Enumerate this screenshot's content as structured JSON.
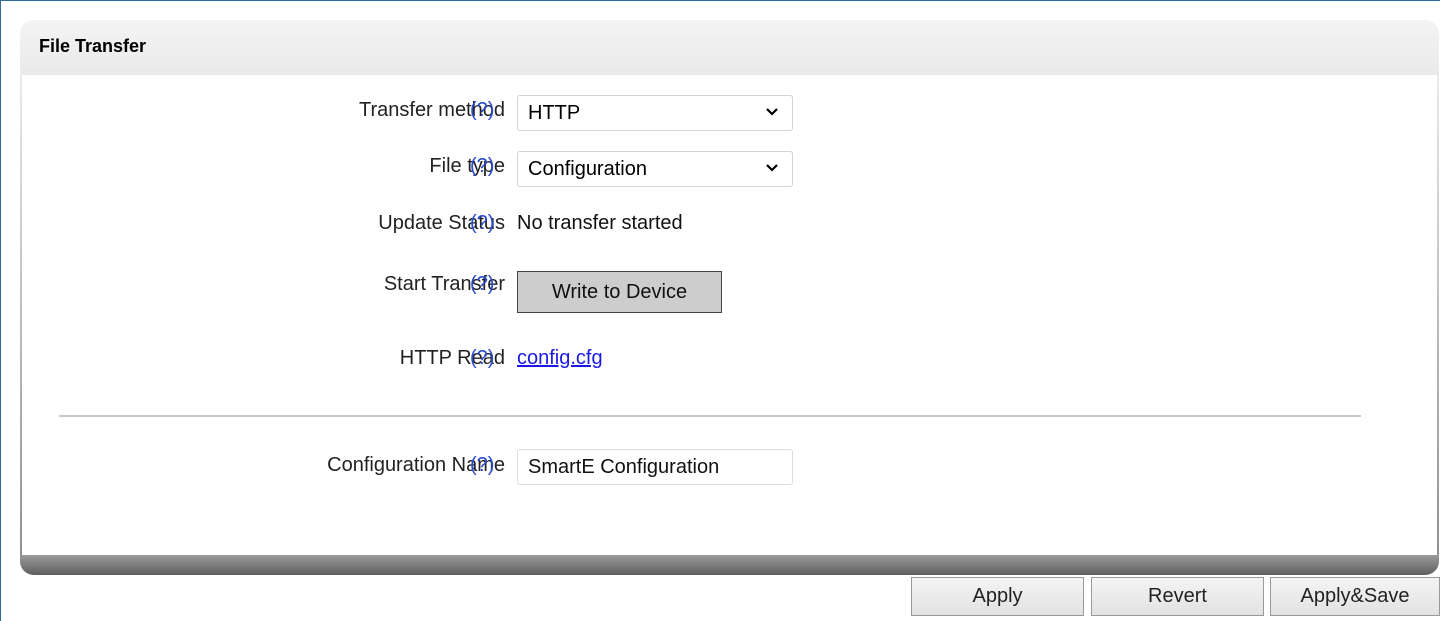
{
  "panel": {
    "title": "File Transfer"
  },
  "fields": {
    "transfer_method": {
      "label": "Transfer method",
      "help": "(?)",
      "value": "HTTP"
    },
    "file_type": {
      "label": "File type",
      "help": "(?)",
      "value": "Configuration"
    },
    "update_status": {
      "label": "Update Status",
      "help": "(?)",
      "value": "No transfer started"
    },
    "start_transfer": {
      "label": "Start Transfer",
      "help": "(?)",
      "button": "Write to Device"
    },
    "http_read": {
      "label": "HTTP Read",
      "help": "(?)",
      "link": "config.cfg"
    },
    "configuration_name": {
      "label": "Configuration Name",
      "help": "(?)",
      "value": "SmartE Configuration"
    }
  },
  "footer": {
    "apply": "Apply",
    "revert": "Revert",
    "apply_save": "Apply&Save"
  },
  "colors": {
    "help": "#2a4cd4",
    "link": "#1a1ae6",
    "frame_border": "#2e6da4"
  }
}
